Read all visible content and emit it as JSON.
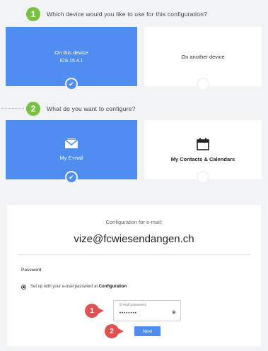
{
  "steps": [
    {
      "number": "1",
      "question": "Which device would you like to use for this configuration?"
    },
    {
      "number": "2",
      "question": "What do you want to configure?"
    }
  ],
  "devices": [
    {
      "title": "On this device",
      "subtitle": "iOS 15.4.1",
      "selected": true
    },
    {
      "title": "On another device",
      "subtitle": "",
      "selected": false
    }
  ],
  "configs": [
    {
      "label": "My E-mail",
      "icon": "envelope-icon",
      "selected": true
    },
    {
      "label": "My Contacts & Calendars",
      "icon": "calendar-icon",
      "selected": false
    }
  ],
  "panel": {
    "heading": "Configuration for e-mail:",
    "email": "vize@fcwiesendangen.ch",
    "password_section": "Password",
    "option_text": "Set up with your e-mail password at",
    "option_bold": "Configuration",
    "password_field_label": "E-mail password",
    "password_value": "••••••••",
    "next_label": "Next"
  },
  "markers": [
    "1",
    "2"
  ],
  "colors": {
    "selected": "#4f8df0",
    "step": "#79c142",
    "marker": "#e15151"
  }
}
